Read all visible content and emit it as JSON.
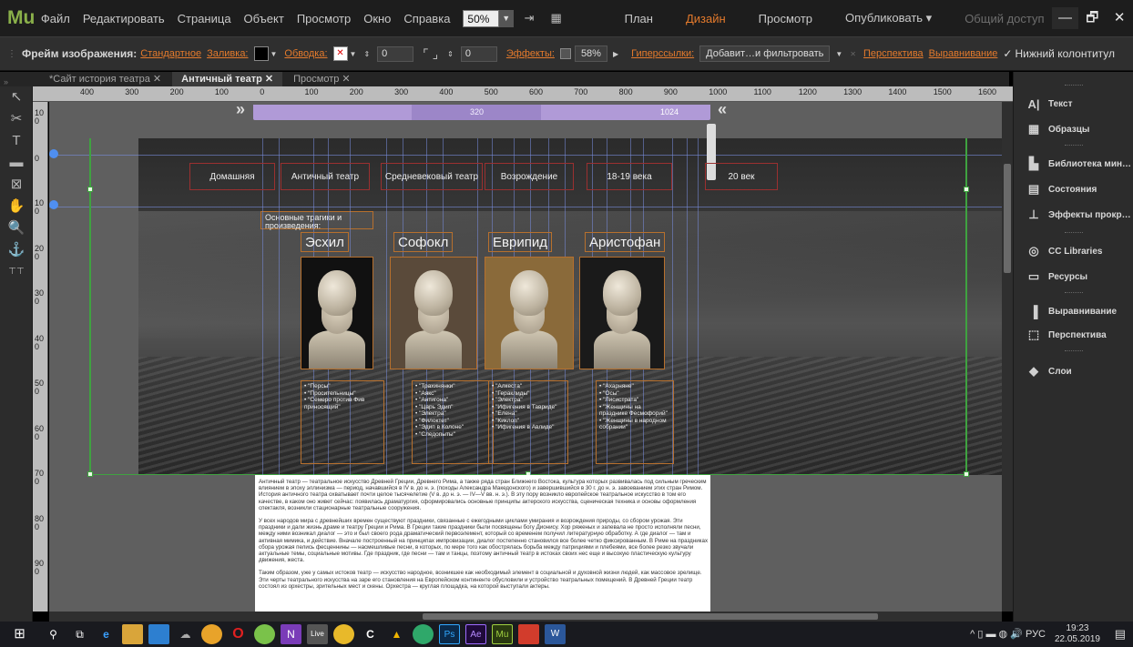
{
  "app": {
    "logo": "Mu"
  },
  "menu": [
    "Файл",
    "Редактировать",
    "Страница",
    "Объект",
    "Просмотр",
    "Окно",
    "Справка"
  ],
  "zoom": {
    "value": "50%"
  },
  "modes": [
    {
      "label": "План",
      "state": "normal"
    },
    {
      "label": "Дизайн",
      "state": "active"
    },
    {
      "label": "Просмотр",
      "state": "normal"
    },
    {
      "label": "Опубликовать ▾",
      "state": "normal"
    },
    {
      "label": "Общий доступ",
      "state": "dim"
    }
  ],
  "window": {
    "minimize": "—",
    "maximize": "🗗",
    "close": "✕"
  },
  "control": {
    "frame_label": "Фрейм изображения:",
    "frame_style": "Стандартное",
    "fill_label": "Заливка:",
    "fill_color": "#000000",
    "stroke_label": "Обводка:",
    "stroke_value": "0",
    "spacing_value": "0",
    "effects_label": "Эффекты:",
    "opacity": "58%",
    "hyperlinks_label": "Гиперссылки:",
    "hyperlink_value": "Добавит…и фильтровать",
    "perspective_label": "Перспектива",
    "align_label": "Выравнивание",
    "footer_label": "Нижний колонтитул"
  },
  "tabs": [
    {
      "label": "*Сайт история театра  ✕",
      "active": false
    },
    {
      "label": "Античный театр  ✕",
      "active": true
    },
    {
      "label": "Просмотр  ✕",
      "active": false
    }
  ],
  "ruler_h": [
    "400",
    "300",
    "200",
    "100",
    "0",
    "100",
    "200",
    "300",
    "400",
    "500",
    "600",
    "700",
    "800",
    "900",
    "1000",
    "1100",
    "1200",
    "1300",
    "1400",
    "1500",
    "1600"
  ],
  "ruler_v": [
    "100",
    "0",
    "100",
    "200",
    "300",
    "400",
    "500",
    "600",
    "700",
    "800",
    "900"
  ],
  "breakpoint": {
    "width_label": "320",
    "right_label": "1024"
  },
  "nav": [
    "Домашняя",
    "Античный театр",
    "Средневековый театр",
    "Возрождение",
    "18-19 века",
    "20 век"
  ],
  "intro": "Основные трагики и произведения:",
  "authors": [
    {
      "name": "Эсхил",
      "works": [
        "\"Персы\"",
        "\"Просительницы\"",
        "\"Семеро против Фив приносящий\""
      ]
    },
    {
      "name": "Софокл",
      "works": [
        "\"Трахинянки\"",
        "\"Аякс\"",
        "\"Антигона\"",
        "\"Царь Эдип\"",
        "\"Электра\"",
        "\"Филоктет\"",
        "\"Эдип в Колоне\"",
        "\"Следопыты\""
      ]
    },
    {
      "name": "Еврипид",
      "works": [
        "\"Алкеста\"",
        "\"Гераклиды\"",
        "\"Электра\"",
        "\"Ифигения в Тавриде\"",
        "\"Елена\"",
        "\"Киклоп\"",
        "\"Ифигения в Авлиде\""
      ]
    },
    {
      "name": "Аристофан",
      "works": [
        "\"Ахарняне\"",
        "\"Осы\"",
        "\"Лисистрата\"",
        "\"Женщины на празднике Фесмофорий\"",
        "\"Женщины в народном собрании\""
      ]
    }
  ],
  "body_paragraphs": [
    "Античный театр — театральное искусство Древней Греции, Древнего Рима, а также ряда стран Ближнего Востока, культура которых развивалась под сильным греческим влиянием в эпоху эллинизма — период, начавшийся в IV в. до н. э. (походы Александра Македонского) и завершившийся в 30 г. до н. э. завоеванием этих стран Римом. История античного театра охватывает почти целое тысячелетие (V в. до н. э. — IV—V вв. н. э.). В эту пору возникло европейское театральное искусство в том его качестве, в каком оно живет сейчас: появилась драматургия, сформировались основные принципы актерского искусства, сценическая техника и основы оформления спектакля, возникли стационарные театральные сооружения.",
    "У всех народов мира с древнейших времен существуют праздники, связанные с ежегодными циклами умирания и возрождения природы, со сбором урожая. Эти праздники и дали жизнь драме и театру Греции и Рима. В Греции такие праздники были посвящены богу Дионису. Хор ряженых и запевала не просто исполняли песни, между ними возникал диалог — это и был своего рода драматический первоэлемент, который со временем получил литературную обработку. А где диалог — там и активная мимика, и действие. Вначале построенный на принципах импровизации, диалог постепенно становился все более четко фиксированным. В Риме на праздниках сбора урожая пелись фесценнины — насмешливые песни, в которых, по мере того как обострялась борьба между патрициями и плебеями, все более резко звучали актуальные темы, социальные мотивы. Где праздник, где песни — там и танцы, поэтому античный театр в истоках своих нес еще и высокую пластическую культуру движения, жеста.",
    "Таким образом, уже у самых истоков театр — искусство народное, возникшее как необходимый элемент в социальной и духовной жизни людей, как массовое зрелище. Эти черты театрального искусства на заре его становления на Европейском континенте обусловили и устройство театральных помещений. В Древней Греции театр состоял из орхестры, зрительных мест и скены. Орхестра — круглая площадка, на которой выступали актеры."
  ],
  "panel": [
    "Текст",
    "Образцы",
    "Библиотека мин…",
    "Состояния",
    "Эффекты прокр…",
    "CC Libraries",
    "Ресурсы",
    "Выравнивание",
    "Перспектива",
    "Слои"
  ],
  "tray": {
    "lang": "РУС",
    "time": "19:23",
    "date": "22.05.2019"
  },
  "colors": {
    "accent": "#e47a2c",
    "brand": "#8ab04a",
    "breakpoint": "#b09ad7",
    "frame": "#b7702d",
    "guide_green": "#3fa240"
  }
}
